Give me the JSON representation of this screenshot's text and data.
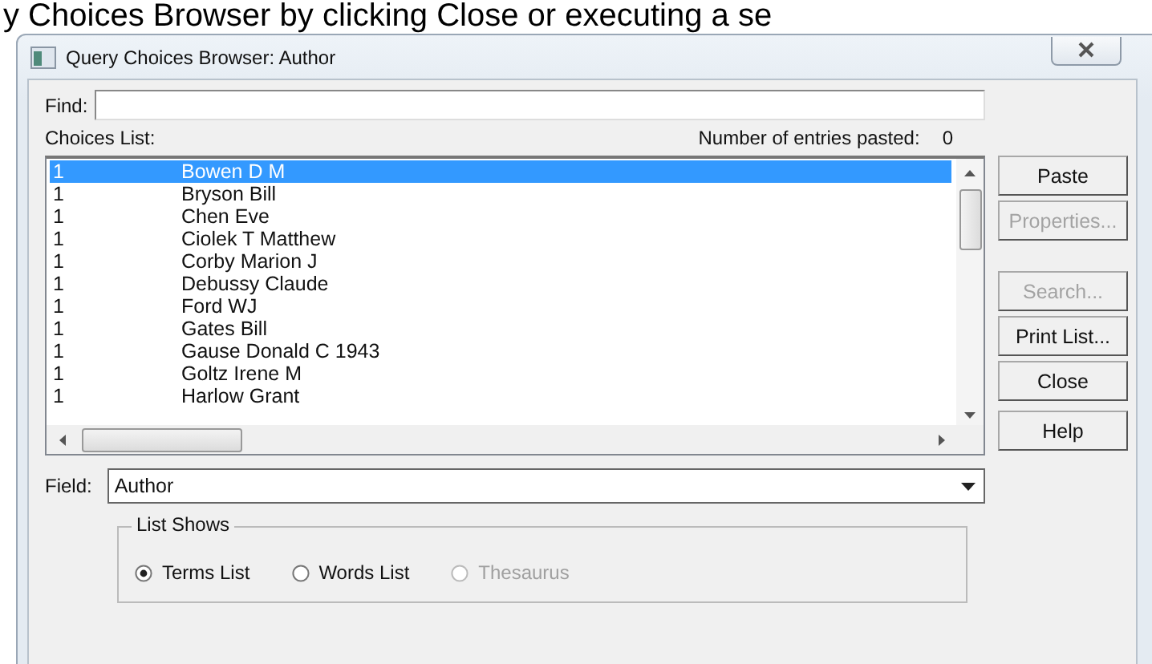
{
  "background_text": "y Choices Browser by clicking Close or executing a se",
  "window": {
    "title": "Query Choices Browser: Author"
  },
  "find": {
    "label": "Find:"
  },
  "choices_list": {
    "label": "Choices List:",
    "pasted_label": "Number of entries pasted:",
    "pasted_count": "0",
    "rows": [
      {
        "count": "1",
        "name": "Bowen D M",
        "selected": true
      },
      {
        "count": "1",
        "name": "Bryson Bill",
        "selected": false
      },
      {
        "count": "1",
        "name": "Chen Eve",
        "selected": false
      },
      {
        "count": "1",
        "name": "Ciolek T Matthew",
        "selected": false
      },
      {
        "count": "1",
        "name": "Corby Marion J",
        "selected": false
      },
      {
        "count": "1",
        "name": "Debussy Claude",
        "selected": false
      },
      {
        "count": "1",
        "name": "Ford WJ",
        "selected": false
      },
      {
        "count": "1",
        "name": "Gates Bill",
        "selected": false
      },
      {
        "count": "1",
        "name": "Gause Donald C 1943",
        "selected": false
      },
      {
        "count": "1",
        "name": "Goltz Irene M",
        "selected": false
      },
      {
        "count": "1",
        "name": "Harlow Grant",
        "selected": false
      }
    ]
  },
  "buttons": [
    {
      "label": "Paste",
      "disabled": false
    },
    {
      "label": "Properties...",
      "disabled": true
    },
    {
      "label": "Search...",
      "disabled": true
    },
    {
      "label": "Print List...",
      "disabled": false
    },
    {
      "label": "Close",
      "disabled": false
    },
    {
      "label": "Help",
      "disabled": false
    }
  ],
  "field": {
    "label": "Field:",
    "value": "Author"
  },
  "list_shows": {
    "title": "List Shows",
    "options": [
      {
        "label": "Terms List",
        "selected": true,
        "disabled": false
      },
      {
        "label": "Words List",
        "selected": false,
        "disabled": false
      },
      {
        "label": "Thesaurus",
        "selected": false,
        "disabled": true
      }
    ]
  }
}
